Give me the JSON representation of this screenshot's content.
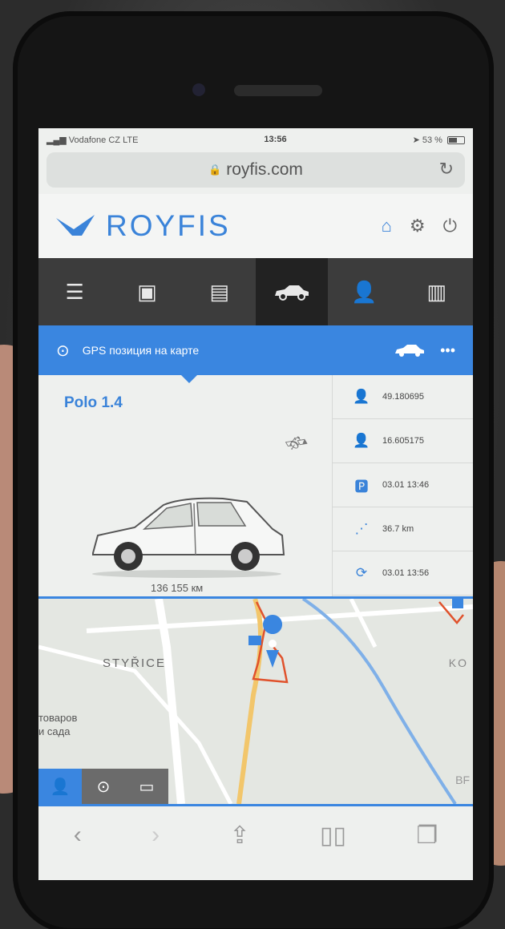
{
  "status_bar": {
    "carrier": "Vodafone CZ",
    "network": "LTE",
    "time": "13:56",
    "battery": "53 %"
  },
  "browser": {
    "url": "royfis.com"
  },
  "brand": {
    "name": "ROYFIS",
    "accent": "#3a83d9"
  },
  "nav": {
    "items": [
      {
        "icon": "settings-sliders-icon"
      },
      {
        "icon": "wallet-icon"
      },
      {
        "icon": "card-icon"
      },
      {
        "icon": "car-icon",
        "active": true
      },
      {
        "icon": "driver-icon"
      },
      {
        "icon": "chart-board-icon"
      }
    ]
  },
  "gps_bar": {
    "label": "GPS позиция на карте"
  },
  "vehicle": {
    "name": "Polo 1.4",
    "odometer": "136 155 км"
  },
  "info_rows": [
    {
      "icon": "latitude-icon",
      "value": "49.180695"
    },
    {
      "icon": "longitude-icon",
      "value": "16.605175"
    },
    {
      "icon": "parking-icon",
      "value": "03.01 13:46"
    },
    {
      "icon": "route-icon",
      "value": "36.7 km"
    },
    {
      "icon": "sync-icon",
      "value": "03.01 13:56"
    }
  ],
  "map": {
    "label_district": "STYŘICE",
    "label_shop": "товаров\nи сада",
    "label_east": "KO",
    "label_corner": "BF"
  },
  "colors": {
    "primary": "#3a86e0",
    "nav_dark": "#3c3c3c",
    "route": "#e0522c"
  }
}
